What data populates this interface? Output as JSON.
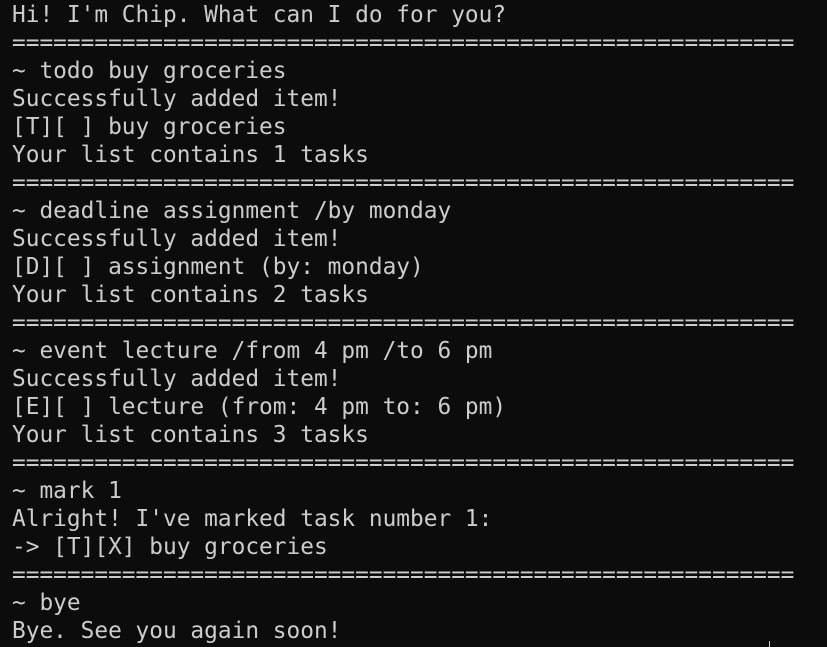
{
  "terminal": {
    "lines": [
      "Hi! I'm Chip. What can I do for you?",
      "=========================================================",
      "~ todo buy groceries",
      "Successfully added item!",
      "[T][ ] buy groceries",
      "Your list contains 1 tasks",
      "=========================================================",
      "~ deadline assignment /by monday",
      "Successfully added item!",
      "[D][ ] assignment (by: monday)",
      "Your list contains 2 tasks",
      "=========================================================",
      "~ event lecture /from 4 pm /to 6 pm",
      "Successfully added item!",
      "[E][ ] lecture (from: 4 pm to: 6 pm)",
      "Your list contains 3 tasks",
      "=========================================================",
      "~ mark 1",
      "Alright! I've marked task number 1:",
      "-> [T][X] buy groceries",
      "=========================================================",
      "~ bye",
      "Bye. See you again soon!"
    ]
  }
}
